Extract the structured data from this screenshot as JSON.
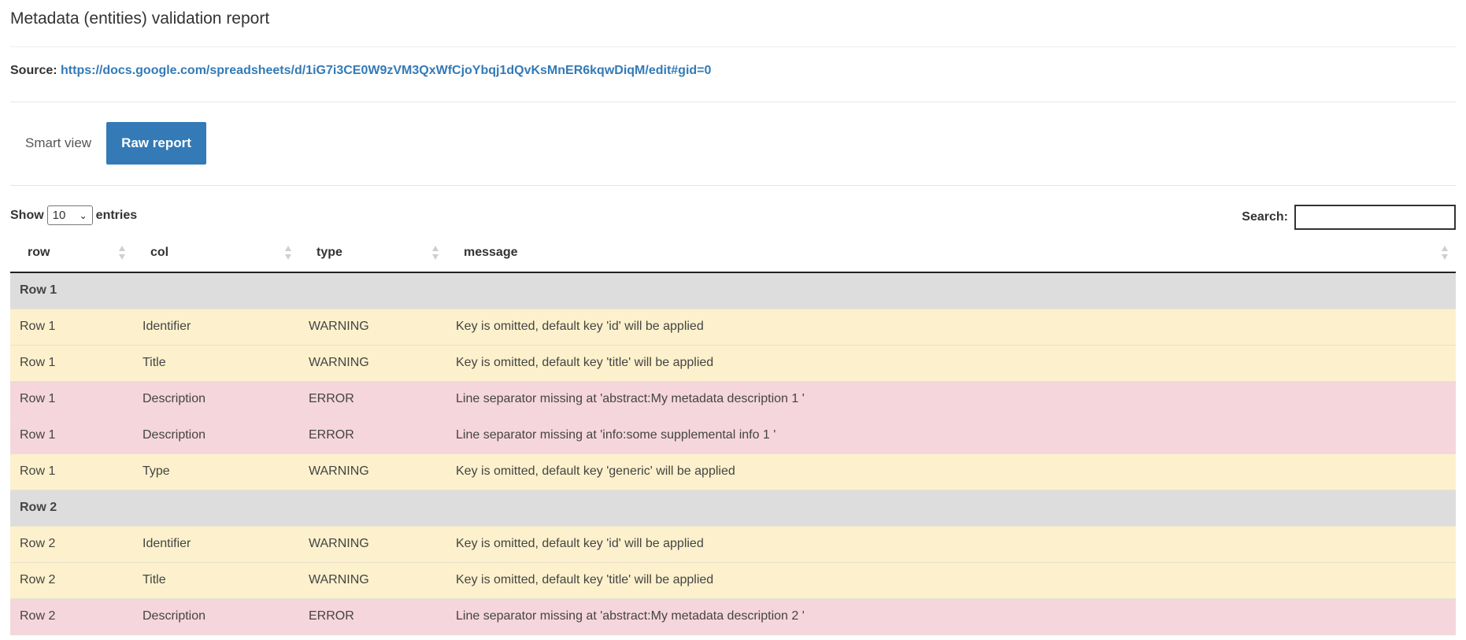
{
  "page": {
    "title": "Metadata (entities) validation report"
  },
  "source": {
    "label": "Source:",
    "url": "https://docs.google.com/spreadsheets/d/1iG7i3CE0W9zVM3QxWfCjoYbqj1dQvKsMnER6kqwDiqM/edit#gid=0"
  },
  "tabs": [
    {
      "label": "Smart view",
      "active": false
    },
    {
      "label": "Raw report",
      "active": true
    }
  ],
  "controls": {
    "show_label": "Show",
    "entries_value": "10",
    "entries_label": "entries",
    "search_label": "Search:",
    "search_value": ""
  },
  "table": {
    "columns": [
      "row",
      "col",
      "type",
      "message"
    ],
    "groups": [
      {
        "label": "Row 1",
        "rows": [
          {
            "row": "Row 1",
            "col": "Identifier",
            "type": "WARNING",
            "message": "Key is omitted, default key 'id' will be applied"
          },
          {
            "row": "Row 1",
            "col": "Title",
            "type": "WARNING",
            "message": "Key is omitted, default key 'title' will be applied"
          },
          {
            "row": "Row 1",
            "col": "Description",
            "type": "ERROR",
            "message": "Line separator missing at 'abstract:My metadata description 1 '"
          },
          {
            "row": "Row 1",
            "col": "Description",
            "type": "ERROR",
            "message": "Line separator missing at 'info:some supplemental info 1 '"
          },
          {
            "row": "Row 1",
            "col": "Type",
            "type": "WARNING",
            "message": "Key is omitted, default key 'generic' will be applied"
          }
        ]
      },
      {
        "label": "Row 2",
        "rows": [
          {
            "row": "Row 2",
            "col": "Identifier",
            "type": "WARNING",
            "message": "Key is omitted, default key 'id' will be applied"
          },
          {
            "row": "Row 2",
            "col": "Title",
            "type": "WARNING",
            "message": "Key is omitted, default key 'title' will be applied"
          },
          {
            "row": "Row 2",
            "col": "Description",
            "type": "ERROR",
            "message": "Line separator missing at 'abstract:My metadata description 2 '"
          }
        ]
      }
    ]
  },
  "colors": {
    "accent": "#337ab7",
    "warning_row": "#fcf1cc",
    "error_row": "#f5d6dc",
    "group_row": "#dddddd"
  }
}
